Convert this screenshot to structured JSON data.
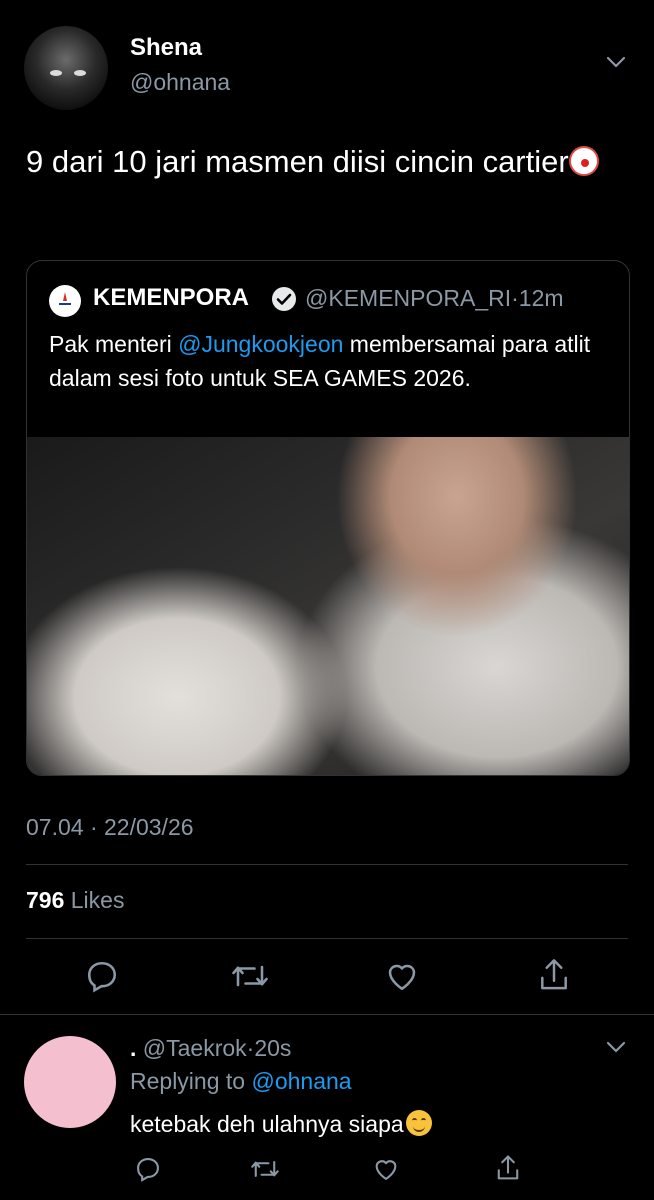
{
  "author": {
    "name": "Shena",
    "handle": "@ohnana",
    "text": "9 dari 10 jari masmen diisi cincin cartier"
  },
  "quote": {
    "name": "KEMENPORA",
    "handle": "@KEMENPORA_RI",
    "time": "12m",
    "separator": "·",
    "text_before": "Pak menteri ",
    "mention": "@Jungkookjeon",
    "text_after": " membersamai para atlit dalam sesi foto untuk SEA GAMES 2026."
  },
  "timestamp": "07.04 · 22/03/26",
  "likes": {
    "count": "796",
    "label": "Likes"
  },
  "reply": {
    "name": ".",
    "handle": "@Taekrok",
    "time": "20s",
    "separator": "·",
    "replying_label": "Replying to",
    "replying_to": "@ohnana",
    "text": "ketebak deh ulahnya siapa"
  },
  "icons": {
    "reply": "reply-icon",
    "retweet": "retweet-icon",
    "like": "heart-icon",
    "share": "share-icon",
    "more": "chevron-down-icon",
    "verified": "verified-badge-icon"
  },
  "colors": {
    "background": "#000000",
    "muted": "#8b98a5",
    "link": "#1d9bf0",
    "border": "#2f3336"
  }
}
